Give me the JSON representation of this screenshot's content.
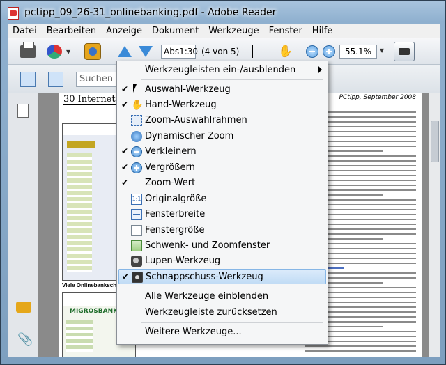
{
  "window": {
    "title": "pctipp_09_26-31_onlinebanking.pdf - Adobe Reader"
  },
  "menubar": [
    "Datei",
    "Bearbeiten",
    "Anzeige",
    "Dokument",
    "Werkzeuge",
    "Fenster",
    "Hilfe"
  ],
  "toolbar": {
    "page_value": "Abs1:30",
    "page_of": "(4 von 5)",
    "zoom_value": "55.1%",
    "search_placeholder": "Suchen"
  },
  "document": {
    "header_left": "30  Internet",
    "header_right": "PCtipp, September 2008",
    "caption1": "Viele Onlinebankschalte",
    "logo2": "MIGROSBANK"
  },
  "dropdown": {
    "items": [
      {
        "label": "Werkzeugleisten ein-/ausblenden",
        "checked": false,
        "submenu": true
      },
      {
        "label": "Auswahl-Werkzeug",
        "checked": true
      },
      {
        "label": "Hand-Werkzeug",
        "checked": true
      },
      {
        "label": "Zoom-Auswahlrahmen",
        "checked": false
      },
      {
        "label": "Dynamischer Zoom",
        "checked": false
      },
      {
        "label": "Verkleinern",
        "checked": true
      },
      {
        "label": "Vergrößern",
        "checked": true
      },
      {
        "label": "Zoom-Wert",
        "checked": true
      },
      {
        "label": "Originalgröße",
        "checked": false
      },
      {
        "label": "Fensterbreite",
        "checked": false
      },
      {
        "label": "Fenstergröße",
        "checked": false
      },
      {
        "label": "Schwenk- und Zoomfenster",
        "checked": false
      },
      {
        "label": "Lupen-Werkzeug",
        "checked": false
      },
      {
        "label": "Schnappschuss-Werkzeug",
        "checked": true,
        "highlighted": true
      },
      {
        "label": "Alle Werkzeuge einblenden",
        "checked": false
      },
      {
        "label": "Werkzeugleiste zurücksetzen",
        "checked": false
      },
      {
        "label": "Weitere Werkzeuge...",
        "checked": false
      }
    ],
    "check_glyph": "✔"
  }
}
